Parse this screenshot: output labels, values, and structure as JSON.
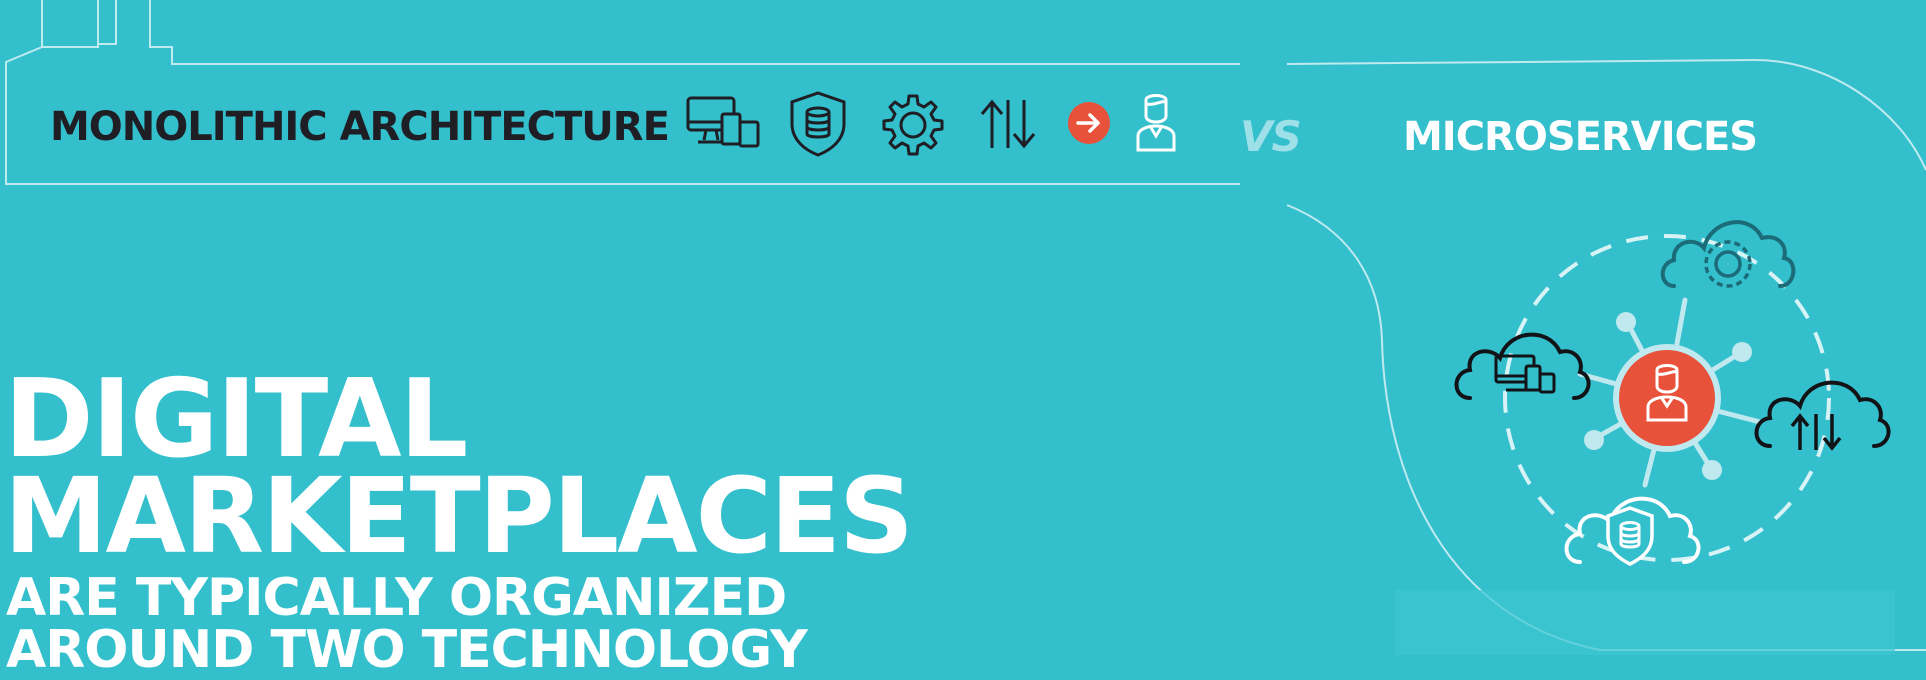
{
  "header": {
    "monolithic_title": "MONOLITHIC ARCHITECTURE",
    "vs_label": "VS",
    "microservices_title": "MICROSERVICES"
  },
  "monolithic_icons": [
    "devices-icon",
    "database-shield-icon",
    "gear-icon",
    "up-down-arrows-icon",
    "arrow-right-icon",
    "user-icon"
  ],
  "microservices_icons": [
    "cloud-gear-icon",
    "cloud-devices-icon",
    "cloud-arrows-icon",
    "cloud-database-icon",
    "user-hub-icon"
  ],
  "headline": {
    "line1": "DIGITAL",
    "line2": "MARKETPLACES"
  },
  "subheadline": {
    "line1": "ARE TYPICALLY ORGANIZED",
    "line2": "AROUND TWO TECHNOLOGY"
  },
  "colors": {
    "background": "#33bfcc",
    "accent": "#e8523a",
    "dark": "#1e1e24",
    "light_line": "#bfeaf0",
    "cloud_teal": "#1b6b78"
  }
}
